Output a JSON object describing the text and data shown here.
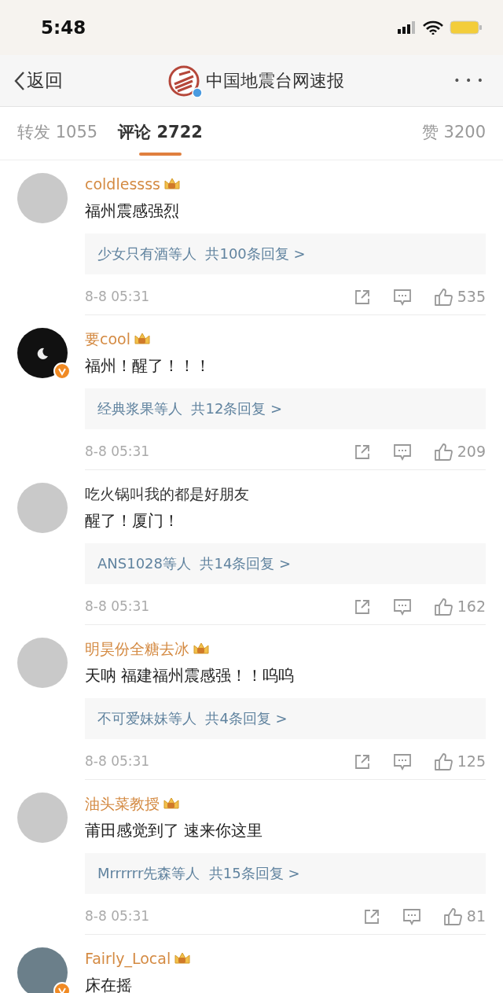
{
  "status_bar": {
    "time": "5:48"
  },
  "nav": {
    "back": "返回",
    "title": "中国地震台网速报",
    "verified": true,
    "more": "• • •"
  },
  "tabs": [
    {
      "label": "转发 1055",
      "selected": false
    },
    {
      "label": "评论 2722",
      "selected": true
    },
    {
      "label": "赞 3200",
      "selected": false
    }
  ],
  "comments": [
    {
      "user": "coldlessss",
      "member": true,
      "verified": false,
      "kind": "photo",
      "text": "福州震感强烈",
      "replies": "少女只有酒等人  共100条回复 >",
      "time": "8-8 05:31",
      "likes": "535"
    },
    {
      "user": "要cool",
      "member": true,
      "verified": true,
      "kind": "moon",
      "text": "福州！醒了！！！",
      "replies": "经典浆果等人  共12条回复 >",
      "time": "8-8 05:31",
      "likes": "209"
    },
    {
      "user": "吃火锅叫我的都是好朋友",
      "member": false,
      "verified": false,
      "kind": "photo",
      "text": "醒了！厦门！",
      "replies": "ANS1028等人  共14条回复 >",
      "time": "8-8 05:31",
      "likes": "162"
    },
    {
      "user": "明昊份全糖去冰",
      "member": true,
      "verified": false,
      "kind": "photo",
      "text": "天呐 福建福州震感强！！呜呜",
      "replies": "不可爱妹妹等人  共4条回复 >",
      "time": "8-8 05:31",
      "likes": "125"
    },
    {
      "user": "油头菜教授",
      "member": true,
      "verified": false,
      "kind": "photo",
      "text": "莆田感觉到了 速来你这里",
      "replies": "Mrrrrrr先森等人  共15条回复 >",
      "time": "8-8 05:31",
      "likes": "81"
    },
    {
      "user": "Fairly_Local",
      "member": true,
      "verified": true,
      "kind": "cartoon",
      "text": "床在摇"
    }
  ]
}
